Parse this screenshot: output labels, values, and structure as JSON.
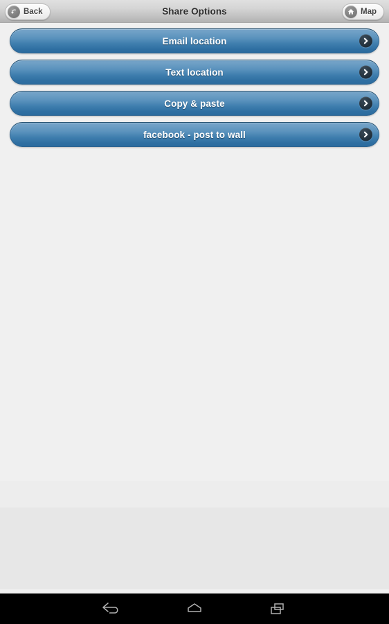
{
  "header": {
    "title": "Share Options",
    "back_button": {
      "label": "Back",
      "icon": "back-arrow-circle-icon"
    },
    "map_button": {
      "label": "Map",
      "icon": "home-circle-icon"
    }
  },
  "main": {
    "options": [
      {
        "label": "Email location",
        "chevron_icon": "chevron-right-icon"
      },
      {
        "label": "Text location",
        "chevron_icon": "chevron-right-icon"
      },
      {
        "label": "Copy & paste",
        "chevron_icon": "chevron-right-icon"
      },
      {
        "label": "facebook - post to wall",
        "chevron_icon": "chevron-right-icon"
      }
    ]
  },
  "navbar": {
    "items": [
      {
        "name": "back",
        "icon": "android-back-icon"
      },
      {
        "name": "home",
        "icon": "android-home-icon"
      },
      {
        "name": "recents",
        "icon": "android-recents-icon"
      }
    ]
  },
  "colors": {
    "button_blue_top": "#76a4c8",
    "button_blue_bottom": "#2b6b9e",
    "button_border": "#2d6491",
    "header_top": "#e0e0e0",
    "header_bottom": "#b2b2b2",
    "content_bg": "#f0f0f0",
    "navbar_bg": "#000000",
    "label_white": "#ffffff"
  }
}
